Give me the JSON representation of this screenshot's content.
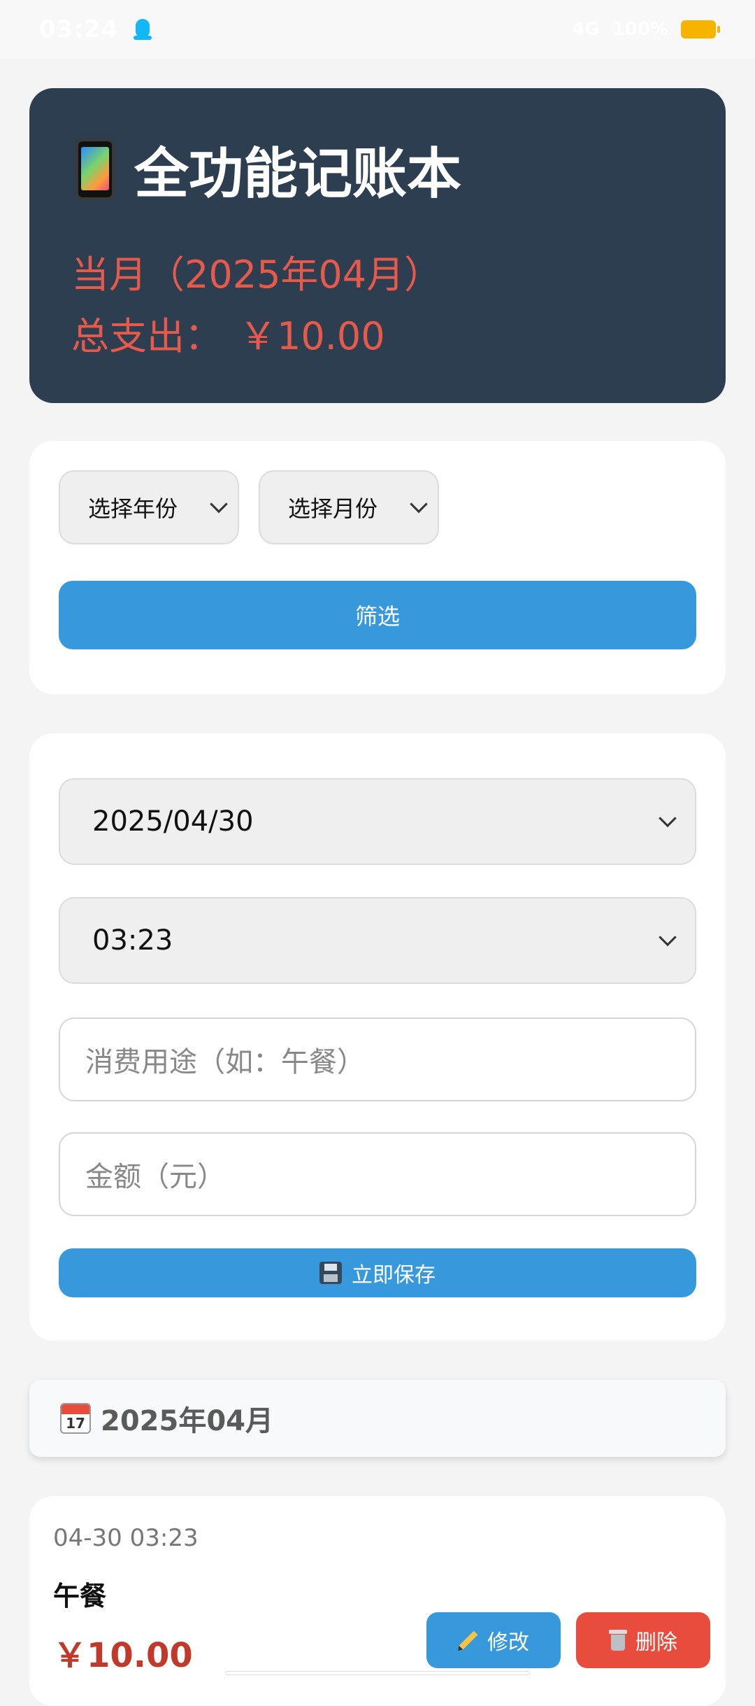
{
  "status_bar": {
    "time": "03:24",
    "signal_text": "4G",
    "battery": "100%"
  },
  "header": {
    "title": "全功能记账本",
    "month_line": "当月（2025年04月）",
    "total_label": "总支出：",
    "total_value": "￥10.00"
  },
  "filter": {
    "year_select": "选择年份",
    "month_select": "选择月份",
    "filter_button": "筛选"
  },
  "form": {
    "date_value": "2025/04/30",
    "time_value": "03:23",
    "purpose_placeholder": "消费用途（如：午餐）",
    "amount_placeholder": "金额（元）",
    "save_button": "立即保存"
  },
  "month_group": {
    "calendar_day": "17",
    "label": "2025年04月"
  },
  "records": [
    {
      "datetime": "04-30 03:23",
      "purpose": "午餐",
      "amount": "￥10.00",
      "edit_label": "修改",
      "delete_label": "删除"
    }
  ]
}
